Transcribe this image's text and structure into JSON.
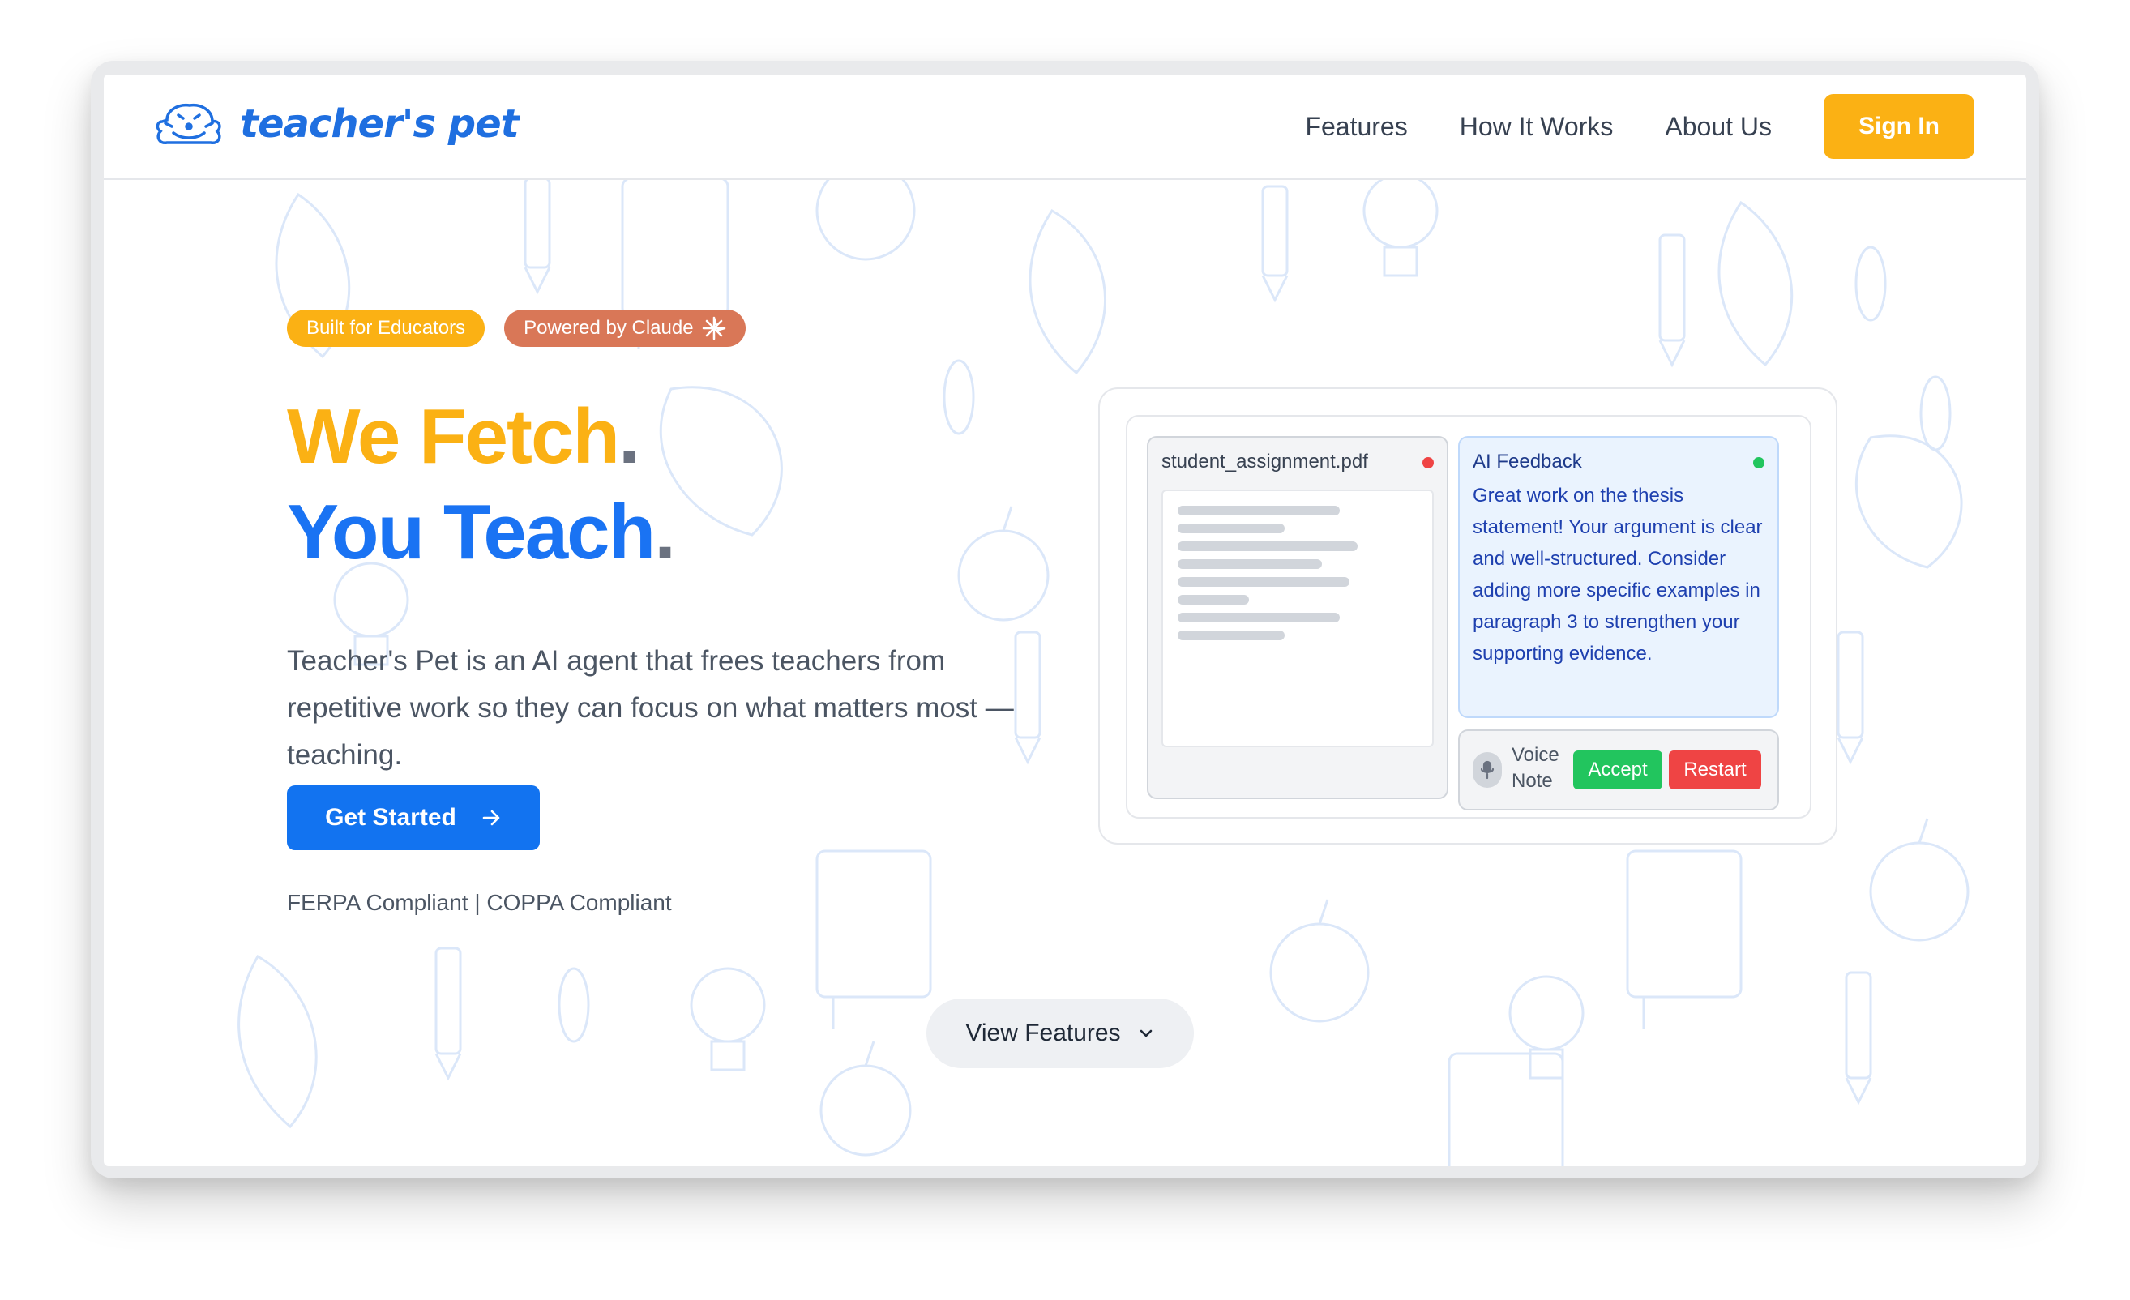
{
  "brand": {
    "logo_text": "teacher's pet",
    "mascot_icon": "dog-mascot-icon",
    "color": "#1f6fe0"
  },
  "nav": {
    "links": [
      "Features",
      "How It Works",
      "About Us"
    ],
    "signin_label": "Sign In"
  },
  "hero": {
    "badges": {
      "educators": "Built for Educators",
      "claude": "Powered by Claude",
      "claude_icon": "sparkle-icon"
    },
    "headline_1": "We Fetch",
    "headline_2": "You Teach",
    "period": ".",
    "description": "Teacher's Pet is an AI agent that frees teachers from repetitive work so they can focus on what matters most —teaching.",
    "cta_label": "Get Started",
    "cta_icon": "arrow-right-icon",
    "compliance": "FERPA Compliant | COPPA Compliant",
    "view_features_label": "View Features",
    "view_features_icon": "chevron-down-icon"
  },
  "demo": {
    "file_name": "student_assignment.pdf",
    "feedback_title": "AI Feedback",
    "feedback_text": "Great work on the thesis statement! Your argument is clear and well-structured. Consider adding more specific examples in paragraph 3 to strengthen your supporting evidence.",
    "voice_note_label": "Voice Note",
    "accept_label": "Accept",
    "restart_label": "Restart"
  },
  "colors": {
    "yellow": "#fbb114",
    "blue": "#1a73f3",
    "claude_orange": "#d97757",
    "accept_green": "#22c55e",
    "restart_red": "#ef4444"
  }
}
